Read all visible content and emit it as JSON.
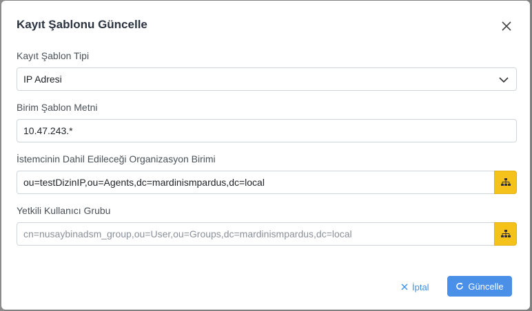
{
  "dialog": {
    "title": "Kayıt Şablonu Güncelle"
  },
  "fields": {
    "template_type": {
      "label": "Kayıt Şablon Tipi",
      "value": "IP Adresi"
    },
    "unit_template_text": {
      "label": "Birim Şablon Metni",
      "value": "10.47.243.*"
    },
    "org_unit": {
      "label": "İstemcinin Dahil Edileceği Organizasyon Birimi",
      "value": "ou=testDizinIP,ou=Agents,dc=mardinismpardus,dc=local"
    },
    "auth_group": {
      "label": "Yetkili Kullanıcı Grubu",
      "value": "cn=nusaybinadsm_group,ou=User,ou=Groups,dc=mardinismpardus,dc=local"
    }
  },
  "buttons": {
    "cancel_label": "İptal",
    "update_label": "Güncelle"
  },
  "colors": {
    "primary": "#4a90e8",
    "addon": "#f4c21b",
    "link": "#3b8ee6"
  },
  "icons": {
    "close": "close-icon",
    "select": "chevron-down-icon",
    "tree": "sitemap-icon",
    "cancel": "x-icon",
    "update": "refresh-icon"
  }
}
